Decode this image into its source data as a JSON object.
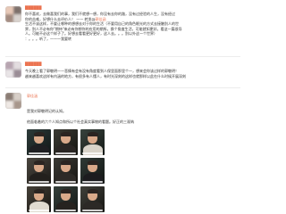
{
  "colors": {
    "mention": "#eb7350",
    "text": "#333333",
    "divider": "#ececec",
    "photo_caption": "#ffffff"
  },
  "posts": [
    {
      "username": "██████",
      "avatar_icon": "avatar-blurred",
      "lines": [
        "你不喜欢，去做喜我们的事，我们不就想一想，你没有去你的路，没有过经验的人生，没有经过",
        "你的苦难，好想什么去评价人！ —— 转发@",
        "生活不该这样，不要让哪种的想想去对于你的生活（不要用自己的角色眼光的方式去接触别人的世",
        "界，别人不必有你\"期待\"来必有你想你的应用的期所。换个角度生活，可能就如更好。看这一篇很导",
        "人。可能不必这个样子了。好想去看看更好更好，这人去。。。别以外这一个世界）"
      ],
      "mention_label": "郭佳涵",
      "mention_suffix": "：。。。听了，一一一我要转"
    },
    {
      "username": "██████",
      "avatar_icon": "avatar-blurred",
      "lines": [
        "今天晚上看了郭敬明——悲情有会有没有角度看到人保里面那里个一，想来会你该过样的郭敬明！",
        "越来越喜欢这样有内涵的地方，有很多有人懂人，有时光深刻的这样也就那样以此在什么时候开展深刻"
      ]
    },
    {
      "username": "郭佳涵",
      "avatar_icon": "avatar-blurred",
      "lines": [
        "是我对郭敬明记的认知。",
        "他面临着的六个人知点和所以个社会真实事物的看题。好正的三观呐"
      ]
    }
  ],
  "photo_grid": {
    "count": 9
  }
}
